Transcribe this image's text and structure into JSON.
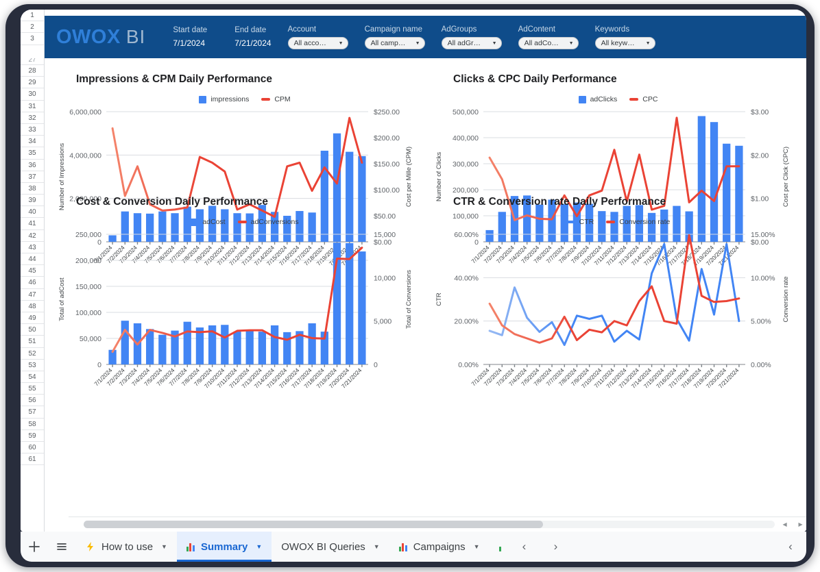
{
  "banner": {
    "logo_primary": "OWOX",
    "logo_secondary": "BI",
    "start_date": {
      "label": "Start date",
      "value": "7/1/2024"
    },
    "end_date": {
      "label": "End date",
      "value": "7/21/2024"
    },
    "filters": [
      {
        "label": "Account",
        "value": "All acco…"
      },
      {
        "label": "Campaign name",
        "value": "All camp…"
      },
      {
        "label": "AdGroups",
        "value": "All adGr…"
      },
      {
        "label": "AdContent",
        "value": "All adCo…"
      },
      {
        "label": "Keywords",
        "value": "All keyw…"
      }
    ],
    "caret_icon": "chevron-down-icon",
    "accent_color": "#0f4c8a",
    "logo_color": "#2f7fd8"
  },
  "gutter": {
    "top_rows": [
      "1",
      "2",
      "3"
    ],
    "rows": [
      "27",
      "28",
      "29",
      "30",
      "31",
      "32",
      "33",
      "34",
      "35",
      "36",
      "37",
      "38",
      "39",
      "40",
      "41",
      "42",
      "43",
      "44",
      "45",
      "46",
      "47",
      "48",
      "49",
      "50",
      "51",
      "52",
      "53",
      "54",
      "55",
      "56",
      "57",
      "58",
      "59",
      "60",
      "61"
    ]
  },
  "colors": {
    "bar_blue": "#4285f4",
    "line_red": "#ea4335",
    "line_red_faded": "#f4846b",
    "line_blue": "#4285f4",
    "line_blue_faded": "#96b9f3",
    "grid": "#dadce0",
    "axis_text": "#5f6368"
  },
  "dates": [
    "7/1/2024",
    "7/2/2024",
    "7/3/2024",
    "7/4/2024",
    "7/5/2024",
    "7/6/2024",
    "7/7/2024",
    "7/8/2024",
    "7/9/2024",
    "7/10/2024",
    "7/11/2024",
    "7/12/2024",
    "7/13/2024",
    "7/14/2024",
    "7/15/2024",
    "7/16/2024",
    "7/17/2024",
    "7/18/2024",
    "7/19/2024",
    "7/20/2024",
    "7/21/2024"
  ],
  "chart_data": [
    {
      "id": "impressions-cpm",
      "type": "bar",
      "title": "Impressions & CPM Daily Performance",
      "xlabel": "",
      "ylabel": "Number of Impressions",
      "y2label": "Cost per Mille (CPM)",
      "categories": [
        "7/1/2024",
        "7/2/2024",
        "7/3/2024",
        "7/4/2024",
        "7/5/2024",
        "7/6/2024",
        "7/7/2024",
        "7/8/2024",
        "7/9/2024",
        "7/10/2024",
        "7/11/2024",
        "7/12/2024",
        "7/13/2024",
        "7/14/2024",
        "7/15/2024",
        "7/16/2024",
        "7/17/2024",
        "7/18/2024",
        "7/19/2024",
        "7/20/2024",
        "7/21/2024"
      ],
      "ylim": [
        0,
        6000000
      ],
      "yticks": [
        "0",
        "2,000,000",
        "4,000,000",
        "6,000,000"
      ],
      "y2lim": [
        0,
        250
      ],
      "y2ticks": [
        "$0.00",
        "$50.00",
        "$100.00",
        "$150.00",
        "$200.00",
        "$250.00"
      ],
      "grid": true,
      "legend": [
        {
          "name": "impressions",
          "kind": "bar",
          "color": "#4285f4"
        },
        {
          "name": "CPM",
          "kind": "line",
          "color": "#ea4335"
        }
      ],
      "series": [
        {
          "name": "impressions",
          "kind": "bar",
          "axis": "left",
          "values": [
            300000,
            1400000,
            1320000,
            1300000,
            1400000,
            1320000,
            1620000,
            1500000,
            1660000,
            1500000,
            1320000,
            1310000,
            1700000,
            1380000,
            1200000,
            1420000,
            1350000,
            4200000,
            5000000,
            4150000,
            3950000
          ]
        },
        {
          "name": "CPM",
          "kind": "line",
          "axis": "right",
          "values": [
            218,
            88,
            145,
            72,
            60,
            62,
            66,
            163,
            152,
            135,
            62,
            72,
            60,
            48,
            145,
            152,
            98,
            143,
            112,
            238,
            152
          ]
        }
      ]
    },
    {
      "id": "clicks-cpc",
      "type": "bar",
      "title": "Clicks & CPC Daily Performance",
      "xlabel": "",
      "ylabel": "Number of Clicks",
      "y2label": "Cost per Click (CPC)",
      "categories": [
        "7/1/2024",
        "7/2/2024",
        "7/3/2024",
        "7/4/2024",
        "7/5/2024",
        "7/6/2024",
        "7/7/2024",
        "7/8/2024",
        "7/9/2024",
        "7/10/2024",
        "7/11/2024",
        "7/12/2024",
        "7/13/2024",
        "7/14/2024",
        "7/15/2024",
        "7/16/2024",
        "7/17/2024",
        "7/18/2024",
        "7/19/2024",
        "7/20/2024",
        "7/21/2024"
      ],
      "ylim": [
        0,
        500000
      ],
      "yticks": [
        "0",
        "100,000",
        "200,000",
        "300,000",
        "400,000",
        "500,000"
      ],
      "y2lim": [
        0,
        3
      ],
      "y2ticks": [
        "$0.00",
        "$1.00",
        "$2.00",
        "$3.00"
      ],
      "grid": true,
      "legend": [
        {
          "name": "adClicks",
          "kind": "bar",
          "color": "#4285f4"
        },
        {
          "name": "CPC",
          "kind": "line",
          "color": "#ea4335"
        }
      ],
      "series": [
        {
          "name": "adClicks",
          "kind": "bar",
          "axis": "left",
          "values": [
            45000,
            115000,
            176000,
            178000,
            143000,
            162000,
            145000,
            151000,
            146000,
            118000,
            115000,
            138000,
            141000,
            111000,
            124000,
            138000,
            117000,
            483000,
            460000,
            377000,
            369000
          ]
        },
        {
          "name": "CPC",
          "kind": "line",
          "axis": "right",
          "values": [
            1.94,
            1.44,
            0.5,
            0.61,
            0.53,
            0.52,
            1.07,
            0.59,
            1.07,
            1.18,
            2.12,
            0.93,
            2.01,
            0.74,
            0.83,
            2.86,
            0.91,
            1.18,
            0.94,
            1.74,
            1.74
          ]
        }
      ]
    },
    {
      "id": "cost-conversion",
      "type": "bar",
      "title": "Cost & Conversion Daily Performance",
      "xlabel": "",
      "ylabel": "Total of adCost",
      "y2label": "Total of Conversions",
      "categories": [
        "7/1/2024",
        "7/2/2024",
        "7/3/2024",
        "7/4/2024",
        "7/5/2024",
        "7/6/2024",
        "7/7/2024",
        "7/8/2024",
        "7/9/2024",
        "7/10/2024",
        "7/11/2024",
        "7/12/2024",
        "7/13/2024",
        "7/14/2024",
        "7/15/2024",
        "7/16/2024",
        "7/17/2024",
        "7/18/2024",
        "7/19/2024",
        "7/20/2024",
        "7/21/2024"
      ],
      "ylim": [
        0,
        250000
      ],
      "yticks": [
        "0",
        "50,000",
        "100,000",
        "150,000",
        "200,000",
        "250,000"
      ],
      "y2lim": [
        0,
        15000
      ],
      "y2ticks": [
        "0",
        "5,000",
        "10,000",
        "15,000"
      ],
      "grid": true,
      "legend": [
        {
          "name": "adCost",
          "kind": "bar",
          "color": "#4285f4"
        },
        {
          "name": "adConversions",
          "kind": "line",
          "color": "#ea4335"
        }
      ],
      "series": [
        {
          "name": "adCost",
          "kind": "bar",
          "axis": "left",
          "values": [
            28000,
            84000,
            79000,
            68000,
            57000,
            65000,
            82000,
            71000,
            75000,
            76000,
            63000,
            64000,
            63000,
            75000,
            62000,
            64000,
            79000,
            63000,
            234000,
            233000,
            217000
          ]
        },
        {
          "name": "adConversions",
          "kind": "line",
          "axis": "right",
          "values": [
            1450,
            3980,
            2300,
            3980,
            3640,
            3220,
            3800,
            3720,
            3820,
            3100,
            3880,
            3940,
            3940,
            3160,
            2850,
            3420,
            3030,
            2980,
            12200,
            12140,
            13450
          ]
        }
      ]
    },
    {
      "id": "ctr-conversion-rate",
      "type": "line",
      "title": "CTR & Conversion rate Daily Performance",
      "xlabel": "",
      "ylabel": "CTR",
      "y2label": "Conversion rate",
      "categories": [
        "7/1/2024",
        "7/2/2024",
        "7/3/2024",
        "7/4/2024",
        "7/5/2024",
        "7/6/2024",
        "7/7/2024",
        "7/8/2024",
        "7/9/2024",
        "7/10/2024",
        "7/11/2024",
        "7/12/2024",
        "7/13/2024",
        "7/14/2024",
        "7/15/2024",
        "7/16/2024",
        "7/17/2024",
        "7/18/2024",
        "7/19/2024",
        "7/20/2024",
        "7/21/2024"
      ],
      "ylim": [
        0,
        60
      ],
      "yticks": [
        "0.00%",
        "20.00%",
        "40.00%",
        "60.00%"
      ],
      "y2lim": [
        0,
        15
      ],
      "y2ticks": [
        "0.00%",
        "5.00%",
        "10.00%",
        "15.00%"
      ],
      "grid": true,
      "legend": [
        {
          "name": "CTR",
          "kind": "line",
          "color": "#4285f4"
        },
        {
          "name": "Conversion rate",
          "kind": "line",
          "color": "#ea4335"
        }
      ],
      "series": [
        {
          "name": "CTR",
          "kind": "line",
          "axis": "left",
          "values": [
            15.5,
            13.5,
            35.5,
            21.5,
            15.0,
            19.5,
            9.0,
            22.5,
            21.0,
            22.5,
            10.5,
            15.5,
            11.5,
            42.0,
            55.5,
            21.0,
            11.0,
            44.0,
            23.0,
            55.5,
            20.0
          ]
        },
        {
          "name": "Conversion rate",
          "kind": "line",
          "axis": "right",
          "values": [
            7.0,
            4.5,
            3.5,
            3.0,
            2.5,
            3.0,
            5.5,
            2.8,
            4.0,
            3.7,
            5.0,
            4.5,
            7.3,
            9.0,
            5.0,
            4.7,
            14.9,
            7.9,
            7.2,
            7.3,
            7.6
          ]
        }
      ]
    }
  ],
  "tabbar": {
    "add_label": "+",
    "add_icon": "plus-icon",
    "menu_icon": "all-sheets-icon",
    "tabs": [
      {
        "label": "How to use",
        "icon": "lightning-icon",
        "active": false
      },
      {
        "label": "Summary",
        "icon": "chart-icon",
        "active": true
      },
      {
        "label": "OWOX BI Queries",
        "icon": "none",
        "active": false
      },
      {
        "label": "Campaigns",
        "icon": "chart-icon",
        "active": false
      }
    ],
    "caret_icon": "chevron-down-icon",
    "prev_icon": "chevron-left-icon",
    "next_icon": "chevron-right-icon",
    "prev_label": "‹",
    "next_label": "›"
  },
  "scrollbar": {
    "left_arrow_icon": "triangle-left-icon",
    "right_arrow_icon": "triangle-right-icon",
    "left_label": "◀",
    "right_label": "▶"
  }
}
